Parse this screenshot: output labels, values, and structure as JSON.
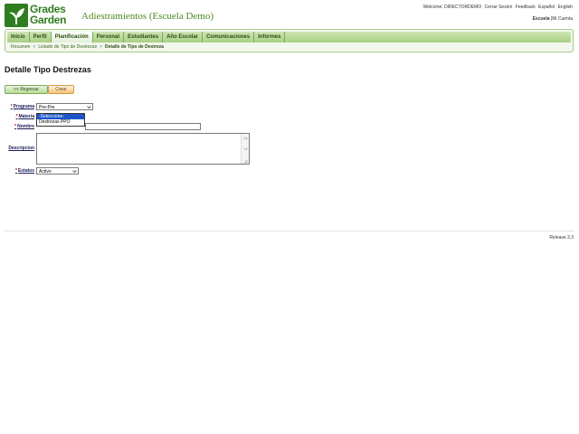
{
  "header": {
    "logo_line1": "Grades",
    "logo_line2": "Garden",
    "app_title": "Adiestramientos (Escuela Demo)",
    "welcome": "Welcome: DIRECTORDEMO",
    "links": [
      "Cerrar Sesion",
      "Feedback",
      "Español",
      "English"
    ],
    "school": "Escuela",
    "my_account": "Mi Cuenta"
  },
  "nav": {
    "tabs": [
      "Inicio",
      "Perfil",
      "Planificación",
      "Personal",
      "Estudiantes",
      "Año Escolar",
      "Comunicaciones",
      "Informes"
    ],
    "active": "Planificación"
  },
  "breadcrumb": {
    "items": [
      "Resumen",
      "Listado de Tipo de Destrezas"
    ],
    "current": "Detalle de Tipo de Destreza"
  },
  "page": {
    "title": "Detalle Tipo Destrezas",
    "back_button": "<< Regresar",
    "create_button": "Crear"
  },
  "form": {
    "programa_label": "Programa",
    "programa_value": "Pre-Pre",
    "materia_label": "Materia",
    "materia_options": [
      "-Seleccione-",
      "Destrezas PPO"
    ],
    "nombre_label": "Nombre",
    "descripcion_label": "Descripcion",
    "estatus_label": "Estatus",
    "estatus_value": "Activo",
    "required_mark": "*"
  },
  "footer": {
    "release": "Release 3.3"
  },
  "colors": {
    "brand_green": "#2e7d1f",
    "nav_green": "#a9cf84",
    "required_red": "#c00000",
    "selected_blue": "#1e56c8"
  }
}
